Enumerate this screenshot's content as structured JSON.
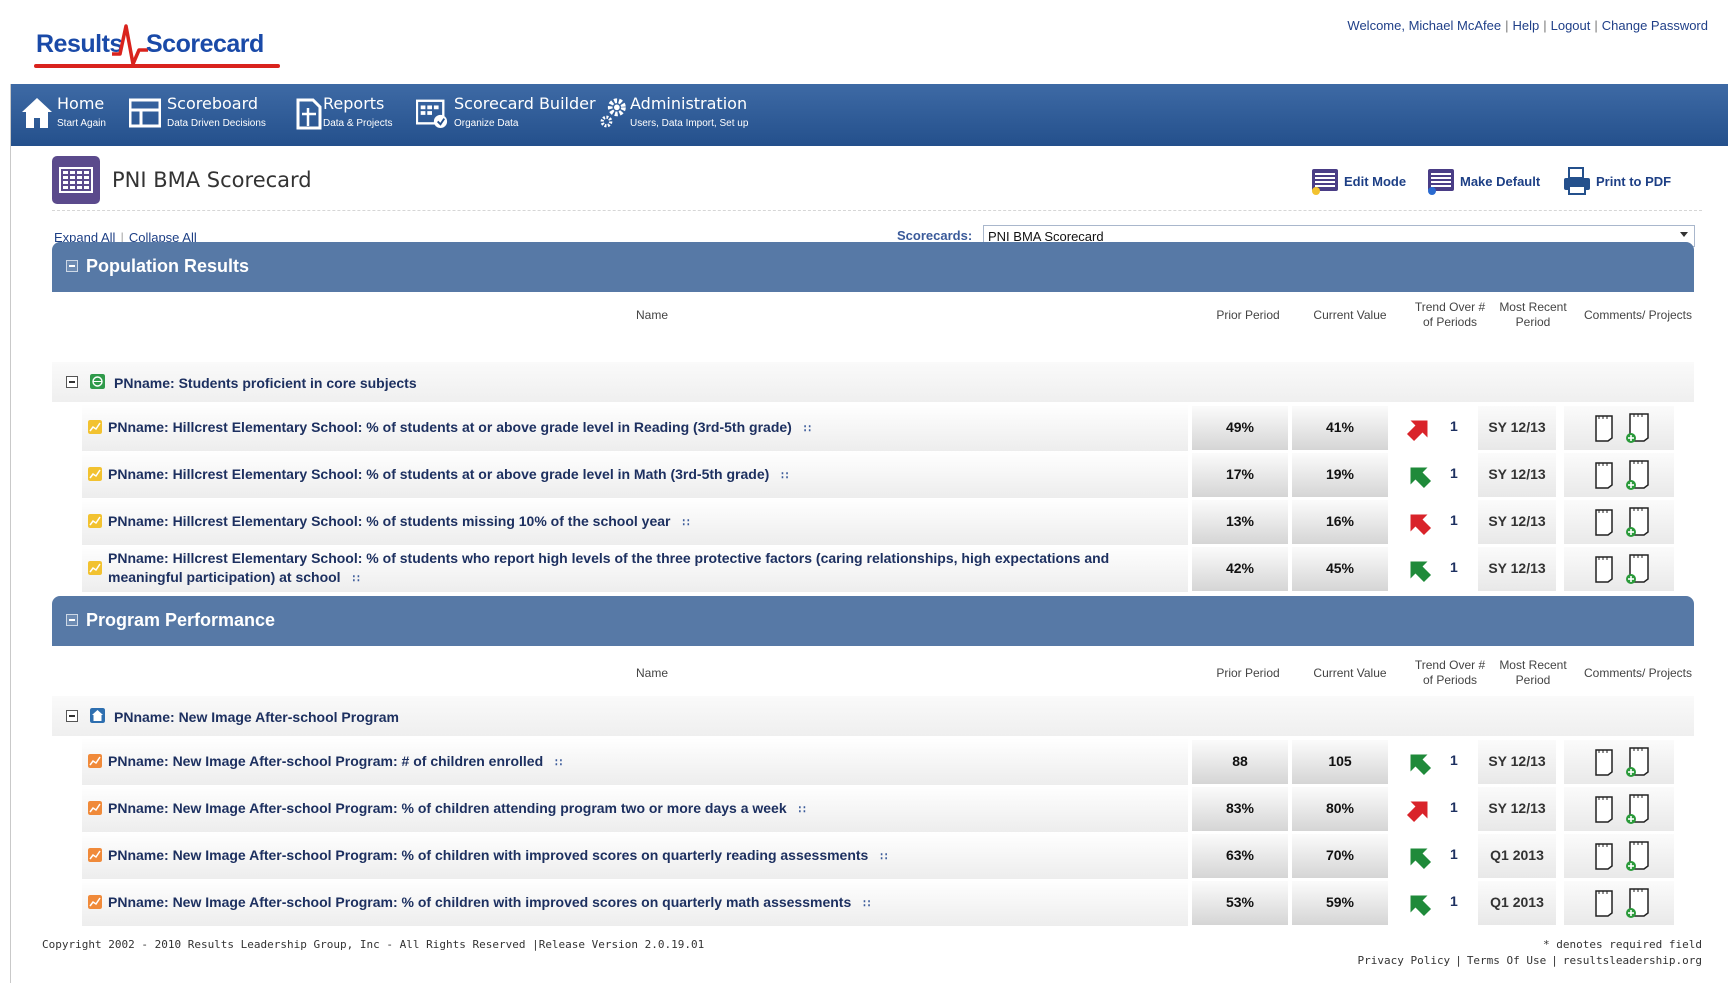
{
  "brand": {
    "logo_part1": "Results",
    "logo_part2": "Scorecard"
  },
  "user_bar": {
    "welcome": "Welcome, Michael McAfee",
    "help": "Help",
    "logout": "Logout",
    "change_password": "Change Password"
  },
  "nav": [
    {
      "title": "Home",
      "subtitle": "Start Again",
      "icon": "home-icon"
    },
    {
      "title": "Scoreboard",
      "subtitle": "Data Driven Decisions",
      "icon": "scoreboard-icon"
    },
    {
      "title": "Reports",
      "subtitle": "Data & Projects",
      "icon": "reports-icon"
    },
    {
      "title": "Scorecard Builder",
      "subtitle": "Organize Data",
      "icon": "builder-icon"
    },
    {
      "title": "Administration",
      "subtitle": "Users, Data Import, Set up",
      "icon": "gear-icon"
    }
  ],
  "page": {
    "title": "PNI BMA Scorecard",
    "edit_mode": "Edit Mode",
    "make_default": "Make Default",
    "print_pdf": "Print to PDF",
    "expand_all": "Expand All",
    "collapse_all": "Collapse All",
    "scorecards_label": "Scorecards:",
    "scorecards_selected": "PNI BMA Scorecard"
  },
  "columns": {
    "name": "Name",
    "prior": "Prior Period",
    "current": "Current Value",
    "trend_l1": "Trend Over #",
    "trend_l2": "of Periods",
    "recent_l1": "Most Recent",
    "recent_l2": "Period",
    "comments": "Comments/ Projects"
  },
  "sections": [
    {
      "title": "Population Results",
      "group": "PNname: Students proficient in core subjects",
      "rows": [
        {
          "name": "PNname: Hillcrest Elementary School: % of students at or above grade level in Reading (3rd-5th grade)",
          "prior": "49%",
          "current": "41%",
          "trend": "down-red",
          "periods": "1",
          "recent": "SY 12/13"
        },
        {
          "name": "PNname: Hillcrest Elementary School: % of students at or above grade level in Math (3rd-5th grade)",
          "prior": "17%",
          "current": "19%",
          "trend": "up-green",
          "periods": "1",
          "recent": "SY 12/13"
        },
        {
          "name": "PNname: Hillcrest Elementary School: % of students missing 10% of the school year",
          "prior": "13%",
          "current": "16%",
          "trend": "up-red",
          "periods": "1",
          "recent": "SY 12/13"
        },
        {
          "name": "PNname: Hillcrest Elementary School: % of students who report high levels of the three protective factors (caring relationships, high expectations and meaningful participation) at school",
          "prior": "42%",
          "current": "45%",
          "trend": "up-green",
          "periods": "1",
          "recent": "SY 12/13"
        }
      ]
    },
    {
      "title": "Program Performance",
      "group": "PNname: New Image After-school Program",
      "rows": [
        {
          "name": "PNname: New Image After-school Program: # of children enrolled",
          "prior": "88",
          "current": "105",
          "trend": "up-green",
          "periods": "1",
          "recent": "SY 12/13"
        },
        {
          "name": "PNname: New Image After-school Program: % of children attending program two or more days a week",
          "prior": "83%",
          "current": "80%",
          "trend": "down-red",
          "periods": "1",
          "recent": "SY 12/13"
        },
        {
          "name": "PNname: New Image After-school Program: % of children with improved scores on quarterly reading assessments",
          "prior": "63%",
          "current": "70%",
          "trend": "up-green",
          "periods": "1",
          "recent": "Q1 2013"
        },
        {
          "name": "PNname: New Image After-school Program: % of children with improved scores on quarterly math assessments",
          "prior": "53%",
          "current": "59%",
          "trend": "up-green",
          "periods": "1",
          "recent": "Q1 2013"
        }
      ]
    }
  ],
  "footer": {
    "copyright": "Copyright 2002 - 2010 Results Leadership Group, Inc - All Rights Reserved |Release Version 2.0.19.01",
    "required": "* denotes required field",
    "privacy": "Privacy Policy",
    "terms": "Terms Of Use",
    "site": "resultsleadership.org"
  },
  "colors": {
    "nav": "#2d5a96",
    "section": "#5779a6",
    "link": "#1d3f85",
    "logo_red": "#d9231d",
    "trend_green": "#1f8a3a",
    "trend_red": "#d9232a"
  }
}
